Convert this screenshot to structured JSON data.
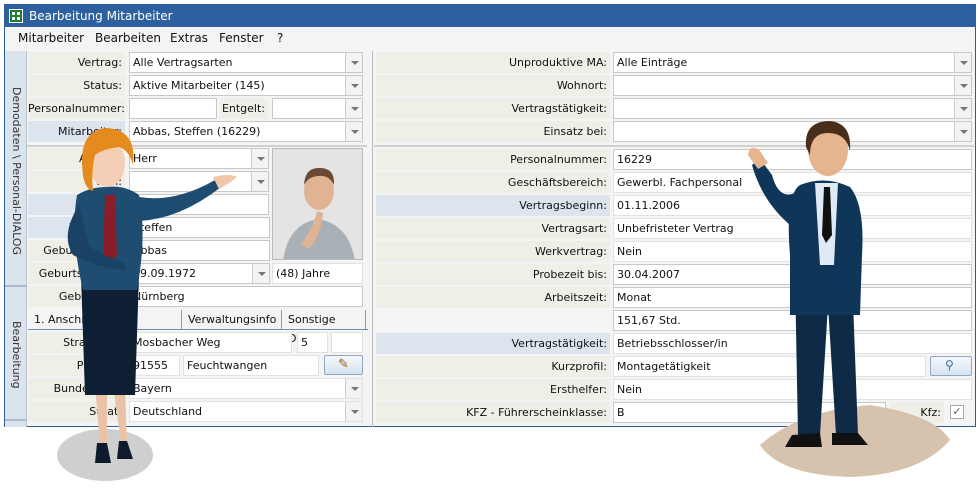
{
  "window": {
    "title": "Bearbeitung Mitarbeiter"
  },
  "menu": [
    "Mitarbeiter",
    "Bearbeiten",
    "Extras",
    "Fenster",
    "?"
  ],
  "side_tabs": [
    "Demodaten \\ Personal-DIALOG Hauptmenü",
    "Bearbeitung Mitarbeiter"
  ],
  "filters_left": [
    {
      "label": "Vertrag:",
      "value": "Alle Vertragsarten",
      "dropdown": true
    },
    {
      "label": "Status:",
      "value": "Aktive Mitarbeiter (145)",
      "dropdown": true
    },
    {
      "label": "Mitarbeiter:",
      "value": "Abbas, Steffen  (16229)",
      "dropdown": true,
      "highlight": true
    }
  ],
  "personalnummer": {
    "label": "Personalnummer:",
    "value": "",
    "entgelt_label": "Entgelt:",
    "entgelt_value": ""
  },
  "person": [
    {
      "label": "Anrede:",
      "value": "Herr",
      "dropdown": true
    },
    {
      "label": "Titel:",
      "value": "",
      "dropdown": true
    },
    {
      "label": "",
      "value": "",
      "highlight": true
    },
    {
      "label": "Vorname:",
      "value": "Steffen",
      "highlight": true
    },
    {
      "label": "Geburtsname:",
      "value": "Abbas"
    },
    {
      "label": "Geburtsdatum:",
      "value": "19.09.1972",
      "dropdown": true,
      "age": "(48) Jahre"
    },
    {
      "label": "Geburtsort:",
      "value": "Nürnberg"
    }
  ],
  "tabs": [
    "1. Anschrift",
    "2. Anschrift",
    "Verwaltungsinfo",
    "Sonstige Daten"
  ],
  "address": {
    "street_label": "Straße/Nr.:",
    "street": "Mosbacher  Weg",
    "number": "5",
    "extra": "",
    "plz_label": "PLZ/Ort:",
    "plz": "91555",
    "city": "Feuchtwangen",
    "state_label": "Bundesland:",
    "state": "Bayern",
    "country_label": "Staat:",
    "country": "Deutschland"
  },
  "filters_right": [
    {
      "label": "Unproduktive MA:",
      "value": "Alle Einträge"
    },
    {
      "label": "Wohnort:",
      "value": ""
    },
    {
      "label": "Vertragstätigkeit:",
      "value": ""
    },
    {
      "label": "Einsatz bei:",
      "value": ""
    }
  ],
  "details": [
    {
      "label": "Personalnummer:",
      "value": "16229"
    },
    {
      "label": "Geschäftsbereich:",
      "value": "Gewerbl. Fachpersonal",
      "ro": true
    },
    {
      "label": "Vertragsbeginn:",
      "value": "01.11.2006",
      "highlight": true,
      "ro": true
    },
    {
      "label": "Vertragsart:",
      "value": "Unbefristeter Vertrag",
      "ro": true
    },
    {
      "label": "Werkvertrag:",
      "value": "Nein",
      "ro": true
    },
    {
      "label": "Probezeit bis:",
      "value": "30.04.2007"
    },
    {
      "label": "Arbeitszeit:",
      "value": "Monat"
    },
    {
      "label": "",
      "value": "151,67 Std."
    },
    {
      "label": "Vertragstätigkeit:",
      "value": "Betriebsschlosser/in",
      "highlight": true,
      "ro": true
    },
    {
      "label": "Kurzprofil:",
      "value": "Montagetätigkeit",
      "ro": true,
      "button": true
    },
    {
      "label": "Ersthelfer:",
      "value": "Nein",
      "ro": true
    },
    {
      "label": "KFZ - Führerscheinklasse:",
      "value": "B",
      "kfz_label": "Kfz:",
      "kfz_checked": true
    }
  ],
  "colors": {
    "titlebar": "#2d609e",
    "label_bg": "#efefe8",
    "label_highlight": "#dce5ee"
  }
}
